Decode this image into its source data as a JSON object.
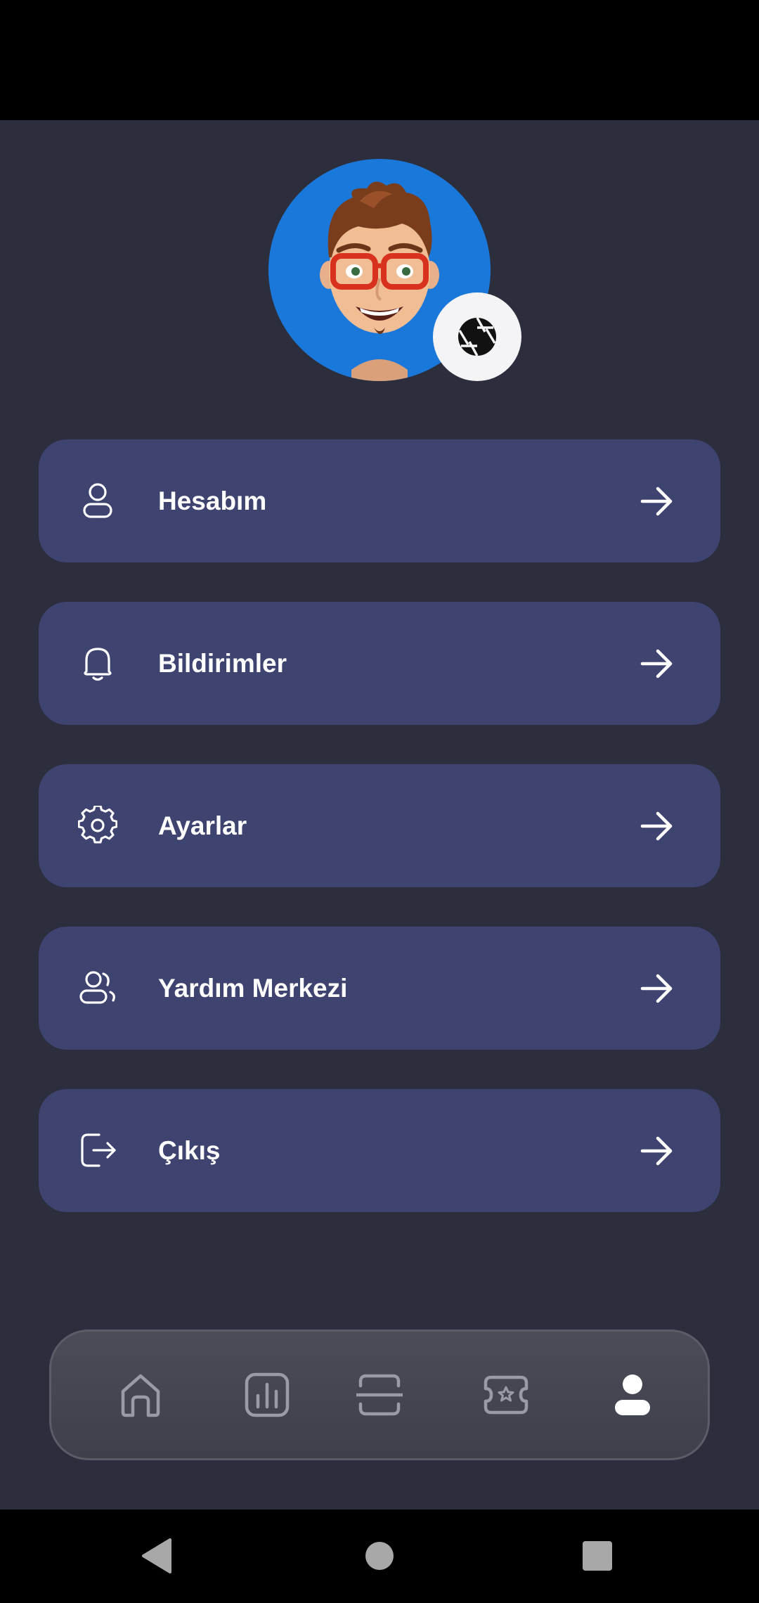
{
  "profile": {
    "avatar_alt": "memoji-avatar",
    "camera_icon": "camera-aperture-icon"
  },
  "menu": {
    "items": [
      {
        "label": "Hesabım",
        "icon": "user-icon"
      },
      {
        "label": "Bildirimler",
        "icon": "bell-icon"
      },
      {
        "label": "Ayarlar",
        "icon": "gear-icon"
      },
      {
        "label": "Yardım Merkezi",
        "icon": "users-icon"
      },
      {
        "label": "Çıkış",
        "icon": "logout-icon"
      }
    ],
    "arrow_icon": "arrow-right-icon"
  },
  "bottom_nav": {
    "items": [
      {
        "icon": "home-icon",
        "active": false
      },
      {
        "icon": "chart-icon",
        "active": false
      },
      {
        "icon": "scan-icon",
        "active": false
      },
      {
        "icon": "ticket-star-icon",
        "active": false
      },
      {
        "icon": "profile-icon",
        "active": true
      }
    ]
  },
  "colors": {
    "background": "#2c2e3d",
    "card": "#3e4370",
    "avatar_bg": "#1a78da",
    "text": "#ffffff",
    "nav_inactive": "#9a9ba4",
    "nav_active": "#ffffff"
  }
}
